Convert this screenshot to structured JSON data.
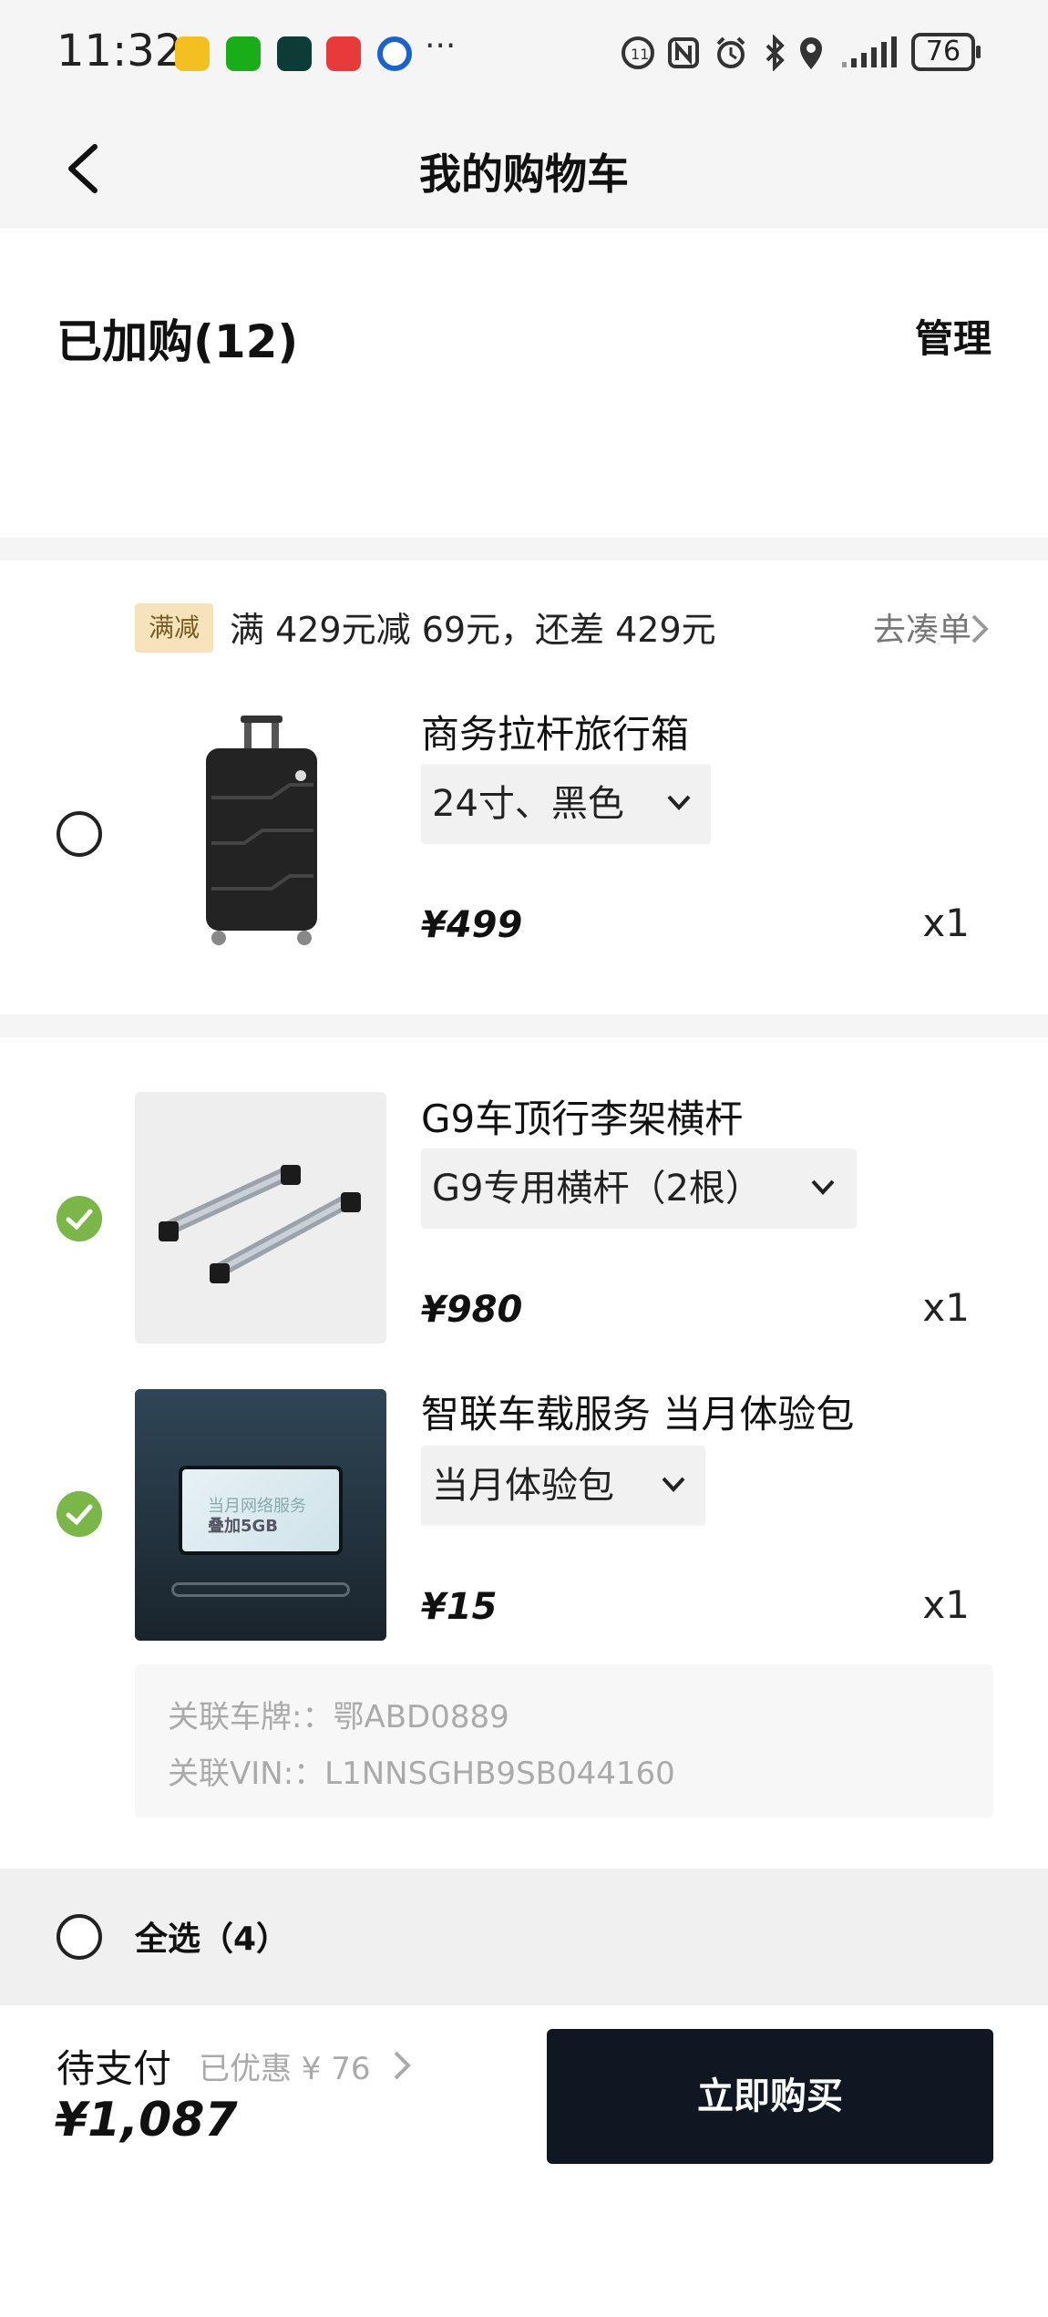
{
  "status_bar": {
    "time": "11:32",
    "more_indicator": "···",
    "battery": "76",
    "icons": [
      "weibo-icon",
      "wechat-icon",
      "app-icon",
      "app-red-icon",
      "app-blue-icon",
      "hd-icon",
      "nfc-icon",
      "alarm-icon",
      "bluetooth-icon",
      "location-icon",
      "signal-icon",
      "battery-icon"
    ]
  },
  "nav": {
    "title": "我的购物车",
    "back_icon": "chevron-left-icon"
  },
  "header": {
    "count_label": "已加购(12)",
    "manage_label": "管理"
  },
  "promo": {
    "tag": "满减",
    "text": "满 429元减 69元，还差 429元",
    "link": "去凑单"
  },
  "items": [
    {
      "name": "商务拉杆旅行箱",
      "spec": "24寸、黑色",
      "price": "¥499",
      "qty": "x1",
      "selected": false
    },
    {
      "name": "G9车顶行李架横杆",
      "spec": "G9专用横杆（2根）",
      "price": "¥980",
      "qty": "x1",
      "selected": true
    },
    {
      "name": "智联车载服务 当月体验包",
      "spec": "当月体验包",
      "price": "¥15",
      "qty": "x1",
      "selected": true,
      "image_text": [
        "当月网络服务",
        "叠加5GB"
      ]
    }
  ],
  "plate": {
    "plate_line": "关联车牌:：鄂ABD0889",
    "vin_line": "关联VIN:：L1NNSGHB9SB044160"
  },
  "select_all": {
    "label": "全选（4）"
  },
  "footer": {
    "pay_label": "待支付",
    "discount": "已优惠 ¥ 76",
    "total": "¥1,087",
    "buy_label": "立即购买"
  },
  "colors": {
    "check": "#7ab648",
    "buy_button": "#0f1722",
    "promo_tag_bg": "#f6e3bc"
  }
}
